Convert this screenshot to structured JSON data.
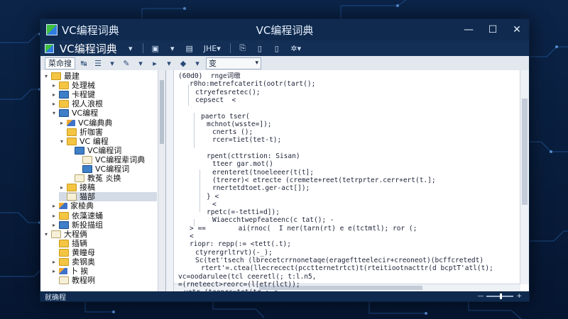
{
  "window": {
    "title_left": "VC编程词典",
    "title_center": "VC编程词典",
    "controls": {
      "minimize": "—",
      "maximize": "☐",
      "close": "✕"
    }
  },
  "menubar": {
    "title": "VC编程词典",
    "buttons": [
      "▾",
      "▣",
      "▾",
      "▤",
      "JHE▾",
      "⎘",
      "▯",
      "▯",
      "✲▾"
    ]
  },
  "toolbar": {
    "tab_label": "菜命搜",
    "buttons": [
      "↹",
      "☰",
      "▾",
      "✎",
      "▾",
      "▸",
      "▾",
      "◆",
      "▾"
    ],
    "dropdown_value": "变"
  },
  "tree": {
    "items": [
      {
        "label": "最建",
        "level": 0,
        "twisty": "▾",
        "icon": "folder-icon",
        "selected": false
      },
      {
        "label": "处理械",
        "level": 1,
        "twisty": "▸",
        "icon": "folder-icon",
        "selected": false
      },
      {
        "label": "卡程键",
        "level": 1,
        "twisty": "▸",
        "icon": "book-icon",
        "selected": false
      },
      {
        "label": "视人浪根",
        "level": 1,
        "twisty": "▸",
        "icon": "folder-icon",
        "selected": false
      },
      {
        "label": "VC编程",
        "level": 1,
        "twisty": "▾",
        "icon": "book-icon",
        "selected": false
      },
      {
        "label": "VC编典典",
        "level": 2,
        "twisty": "▸",
        "icon": "pen-icon",
        "selected": false
      },
      {
        "label": "折咖害",
        "level": 2,
        "twisty": "",
        "icon": "folder-icon",
        "selected": false
      },
      {
        "label": "VC 编程",
        "level": 2,
        "twisty": "▾",
        "icon": "folder-icon",
        "selected": false
      },
      {
        "label": "VC编程词",
        "level": 3,
        "twisty": "",
        "icon": "book-icon",
        "selected": false
      },
      {
        "label": "VC编程辈词典",
        "level": 4,
        "twisty": "",
        "icon": "doc-icon",
        "selected": false
      },
      {
        "label": "VC编程词",
        "level": 4,
        "twisty": "",
        "icon": "book-icon",
        "selected": false
      },
      {
        "label": "教菟 炎换",
        "level": 3,
        "twisty": "",
        "icon": "doc-icon",
        "selected": false
      },
      {
        "label": "接稿",
        "level": 2,
        "twisty": "▸",
        "icon": "folder-icon",
        "selected": false
      },
      {
        "label": "猫部",
        "level": 2,
        "twisty": "",
        "icon": "doc-icon",
        "selected": true
      },
      {
        "label": "家棱典",
        "level": 1,
        "twisty": "▸",
        "icon": "pen-icon",
        "selected": false
      },
      {
        "label": "依藻速蛹",
        "level": 1,
        "twisty": "▸",
        "icon": "folder-icon",
        "selected": false
      },
      {
        "label": "新投描组",
        "level": 1,
        "twisty": "▸",
        "icon": "book-icon",
        "selected": false
      },
      {
        "label": "大程俩",
        "level": 0,
        "twisty": "▾",
        "icon": "doc-icon",
        "selected": false
      },
      {
        "label": "插辆",
        "level": 1,
        "twisty": "",
        "icon": "folder-icon",
        "selected": false
      },
      {
        "label": "黄瞳母",
        "level": 1,
        "twisty": "",
        "icon": "folder-icon",
        "selected": false
      },
      {
        "label": "卖钢奥",
        "level": 1,
        "twisty": "▸",
        "icon": "folder-icon",
        "selected": false
      },
      {
        "label": "卜 挨",
        "level": 1,
        "twisty": "▸",
        "icon": "pen-icon",
        "selected": false
      },
      {
        "label": "教程咧",
        "level": 1,
        "twisty": "",
        "icon": "doc-icon",
        "selected": false
      }
    ]
  },
  "editor": {
    "lines": [
      {
        "text": "(6ΘdΘ)  rnge词缴",
        "indent": 0
      },
      {
        "text": "r0ho:metrefcaterit(ootr(tart();",
        "indent": 2
      },
      {
        "text": "ctryefesretec();",
        "indent": 3
      },
      {
        "text": "cepsect  <",
        "indent": 3
      },
      {
        "text": "",
        "indent": 0
      },
      {
        "text": "paerto tser(",
        "indent": 4
      },
      {
        "text": "mchnot(wsste=]);",
        "indent": 5
      },
      {
        "text": "cnerts ();",
        "indent": 6
      },
      {
        "text": "rcer=tiet(tet-t);",
        "indent": 6
      },
      {
        "text": "",
        "indent": 0
      },
      {
        "text": "rpent(cttrstion: Sisan)",
        "indent": 5
      },
      {
        "text": "tteer gar.mot()",
        "indent": 6
      },
      {
        "text": "erenteret(tnoeleeer(t(t];",
        "indent": 6
      },
      {
        "text": "(trerer)< etrecte (cremete+reet(tetrprter.cerr+ert(t.];",
        "indent": 6
      },
      {
        "text": "rnertetdtoet.ger-act[]);",
        "indent": 6
      },
      {
        "text": "} <",
        "indent": 5
      },
      {
        "text": "<",
        "indent": 6
      },
      {
        "text": "rpetc(=-tetti=d]);",
        "indent": 5
      },
      {
        "text": "Wiaecchtwepfeateenc(c tat(); -",
        "indent": 6
      },
      {
        "text": "> ==        ai(rnoc(  I ner(tarn(rt) e e(tctmtl); ror (;",
        "indent": 2
      },
      {
        "text": "< ",
        "indent": 2
      },
      {
        "text": "riopr: repp(:= <tett(.t);",
        "indent": 2
      },
      {
        "text": "ctyrergrltrvt)(-_);",
        "indent": 3
      },
      {
        "text": "Sc(tet'tsech (lbrecetcrrnonetaqe(erageftteelecir+creoneot)(bcffcretedt)",
        "indent": 3
      },
      {
        "text": "rtert'=.ctea(llecrecect(pcctternetrtct)t(rteitiootnacttr(d bcptT'atl(t);",
        "indent": 4
      },
      {
        "text": "vc=oodarulee(tcl ceeretl(; t:l.n5,",
        "indent": 0
      },
      {
        "text": "=(rneteect>reorc=(l[etr(lct));",
        "indent": 0
      },
      {
        "text": "vetr (teenrc=tet(tr-; <",
        "indent": 1
      }
    ]
  },
  "statusbar": {
    "text": "就确程",
    "zoom_level": 0.55
  }
}
